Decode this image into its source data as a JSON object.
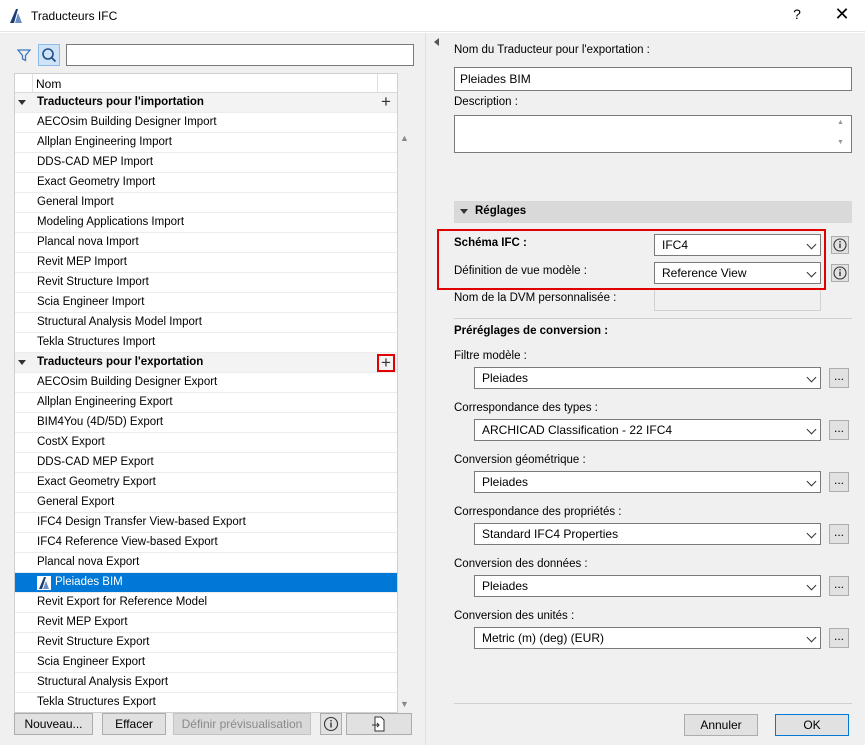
{
  "window": {
    "title": "Traducteurs IFC",
    "help_label": "?",
    "close_label": "✕"
  },
  "left": {
    "search": {
      "value": "",
      "placeholder": ""
    },
    "column_header": "Nom",
    "import_group": {
      "label": "Traducteurs pour l'importation",
      "items": [
        "AECOsim Building Designer Import",
        "Allplan Engineering Import",
        "DDS-CAD MEP Import",
        "Exact Geometry Import",
        "General Import",
        "Modeling Applications Import",
        "Plancal nova Import",
        "Revit MEP Import",
        "Revit Structure Import",
        "Scia Engineer Import",
        "Structural Analysis Model Import",
        "Tekla Structures Import"
      ]
    },
    "export_group": {
      "label": "Traducteurs pour l'exportation",
      "items_before": [
        "AECOsim Building Designer Export",
        "Allplan Engineering Export",
        "BIM4You (4D/5D) Export",
        "CostX Export",
        "DDS-CAD MEP Export",
        "Exact Geometry Export",
        "General Export",
        "IFC4 Design Transfer View-based Export",
        "IFC4 Reference View-based Export",
        "Plancal nova Export"
      ],
      "selected": "Pleiades BIM",
      "items_after": [
        "Revit Export for Reference Model",
        "Revit MEP Export",
        "Revit Structure Export",
        "Scia Engineer Export",
        "Structural Analysis Export",
        "Tekla Structures Export"
      ]
    },
    "buttons": {
      "new": "Nouveau...",
      "delete": "Effacer",
      "preview": "Définir prévisualisation"
    }
  },
  "right": {
    "name_label": "Nom du Traducteur pour l'exportation :",
    "name_value": "Pleiades BIM",
    "description_label": "Description :",
    "description_value": "",
    "settings_title": "Réglages",
    "schema_label": "Schéma IFC :",
    "schema_value": "IFC4",
    "mvd_label": "Définition de vue modèle :",
    "mvd_value": "Reference View",
    "custom_mvd_label": "Nom de la DVM personnalisée :",
    "presets_title": "Préréglages de conversion :",
    "presets": [
      {
        "label": "Filtre modèle :",
        "value": "Pleiades"
      },
      {
        "label": "Correspondance des types :",
        "value": "ARCHICAD Classification - 22 IFC4"
      },
      {
        "label": "Conversion géométrique :",
        "value": "Pleiades"
      },
      {
        "label": "Correspondance des propriétés :",
        "value": "Standard IFC4 Properties"
      },
      {
        "label": "Conversion des données :",
        "value": "Pleiades"
      },
      {
        "label": "Conversion des unités :",
        "value": "Metric (m) (deg) (EUR)"
      }
    ],
    "dots_label": "...",
    "cancel": "Annuler",
    "ok": "OK"
  },
  "colors": {
    "selection": "#0078d7",
    "highlight": "#e00000",
    "panel": "#f0f0f0"
  }
}
